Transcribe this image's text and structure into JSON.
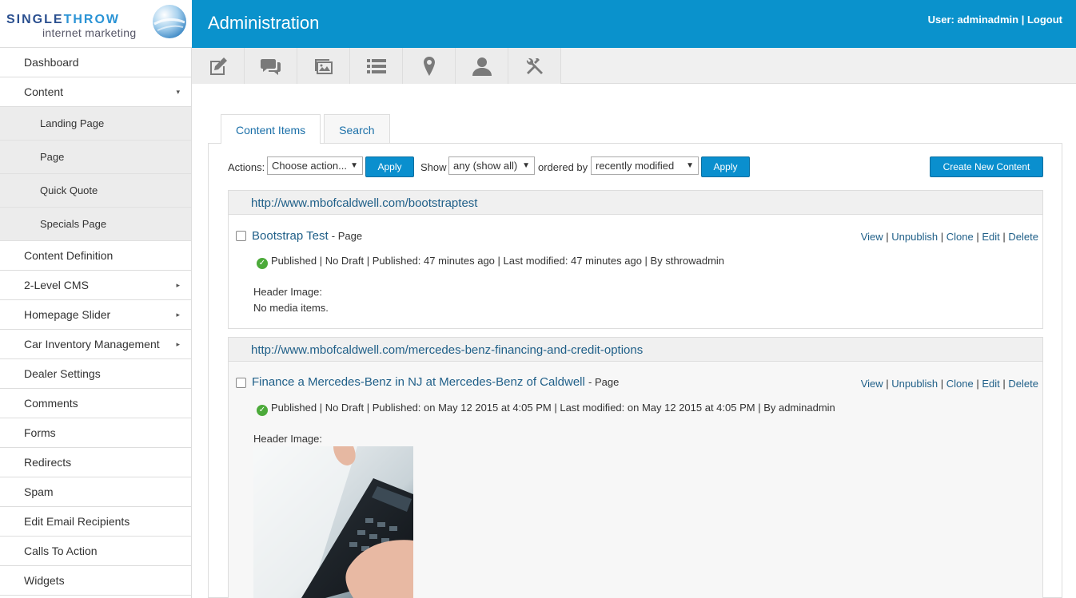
{
  "logo": {
    "word1": "SINGLE",
    "word2": "THROW",
    "tagline": "internet marketing"
  },
  "header": {
    "title": "Administration",
    "user_label": "User: adminadmin",
    "sep": "|",
    "logout": "Logout"
  },
  "sidebar": {
    "items": [
      {
        "label": "Dashboard"
      },
      {
        "label": "Content"
      },
      {
        "label": "Landing Page"
      },
      {
        "label": "Page"
      },
      {
        "label": "Quick Quote"
      },
      {
        "label": "Specials Page"
      },
      {
        "label": "Content Definition"
      },
      {
        "label": "2-Level CMS"
      },
      {
        "label": "Homepage Slider"
      },
      {
        "label": "Car Inventory Management"
      },
      {
        "label": "Dealer Settings"
      },
      {
        "label": "Comments"
      },
      {
        "label": "Forms"
      },
      {
        "label": "Redirects"
      },
      {
        "label": "Spam"
      },
      {
        "label": "Edit Email Recipients"
      },
      {
        "label": "Calls To Action"
      },
      {
        "label": "Widgets"
      }
    ]
  },
  "toolbar": {
    "icons": [
      "edit-icon",
      "comments-icon",
      "media-icon",
      "list-icon",
      "map-marker-icon",
      "user-icon",
      "tools-icon"
    ]
  },
  "tabs": [
    {
      "label": "Content Items"
    },
    {
      "label": "Search"
    }
  ],
  "actions": {
    "actions_label": "Actions:",
    "action_select": "Choose action...",
    "apply1": "Apply",
    "show_label": "Show",
    "show_select": "any (show all)",
    "ordered_label": "ordered by",
    "order_select": "recently modified",
    "apply2": "Apply",
    "create": "Create New Content"
  },
  "groups": [
    {
      "url": "http://www.mbofcaldwell.com/bootstraptest",
      "title": "Bootstrap Test",
      "type": "- Page",
      "links": [
        "View",
        "Unpublish",
        "Clone",
        "Edit",
        "Delete"
      ],
      "status": "Published | No Draft | Published: 47 minutes ago | Last modified: 47 minutes ago | By sthrowadmin",
      "header_label": "Header Image:",
      "header_value": "No media items."
    },
    {
      "url": "http://www.mbofcaldwell.com/mercedes-benz-financing-and-credit-options",
      "title": "Finance a Mercedes-Benz in NJ at Mercedes-Benz of Caldwell",
      "type": "- Page",
      "links": [
        "View",
        "Unpublish",
        "Clone",
        "Edit",
        "Delete"
      ],
      "status": "Published | No Draft | Published: on May 12 2015 at 4:05 PM | Last modified: on May 12 2015 at 4:05 PM | By adminadmin",
      "header_label": "Header Image:"
    }
  ]
}
